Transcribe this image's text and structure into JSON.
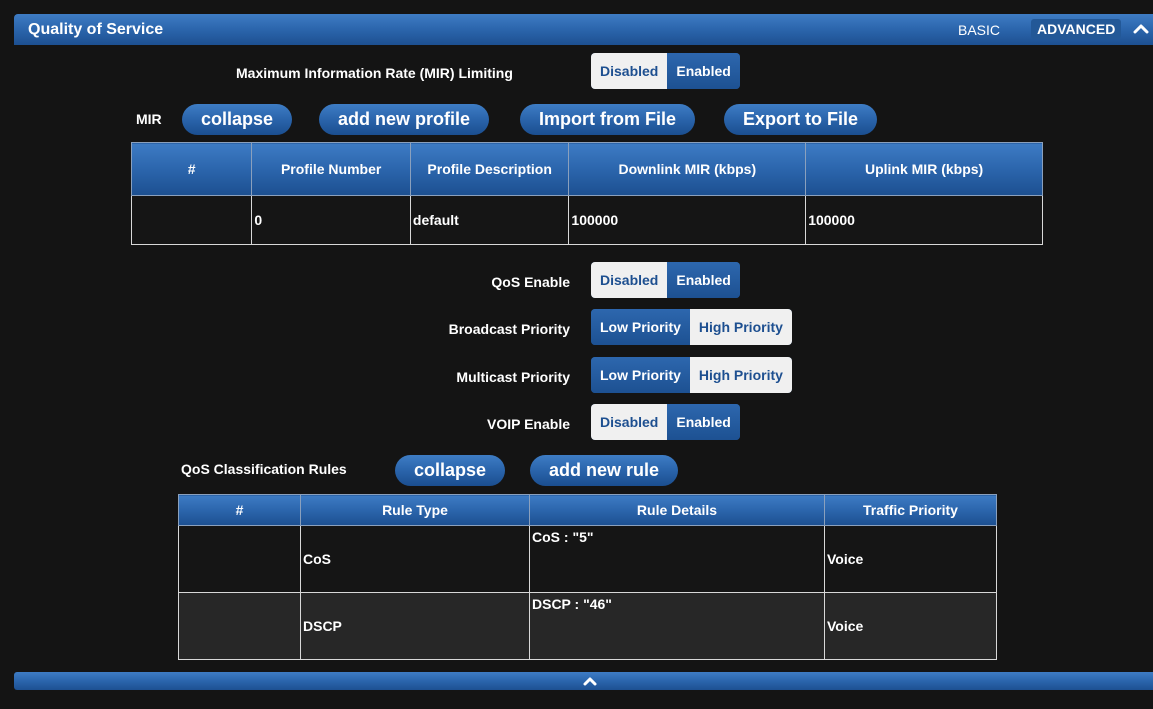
{
  "header": {
    "title": "Quality of Service",
    "basic_label": "BASIC",
    "advanced_label": "ADVANCED",
    "collapse_icon": "chevron-up-icon"
  },
  "mir_limiting": {
    "label": "Maximum Information Rate (MIR) Limiting",
    "options": [
      "Disabled",
      "Enabled"
    ],
    "selected": "Enabled"
  },
  "mir": {
    "label": "MIR",
    "collapse_label": "collapse",
    "add_profile_label": "add new profile",
    "import_label": "Import from File",
    "export_label": "Export to File",
    "table": {
      "headers": [
        "#",
        "Profile Number",
        "Profile Description",
        "Downlink MIR (kbps)",
        "Uplink MIR (kbps)"
      ],
      "rows": [
        {
          "index": "",
          "profile_number": "0",
          "description": "default",
          "downlink": "100000",
          "uplink": "100000"
        }
      ]
    }
  },
  "qos_enable": {
    "label": "QoS Enable",
    "options": [
      "Disabled",
      "Enabled"
    ],
    "selected": "Enabled"
  },
  "broadcast_priority": {
    "label": "Broadcast Priority",
    "options": [
      "Low Priority",
      "High Priority"
    ],
    "selected": "Low Priority"
  },
  "multicast_priority": {
    "label": "Multicast Priority",
    "options": [
      "Low Priority",
      "High Priority"
    ],
    "selected": "Low Priority"
  },
  "voip_enable": {
    "label": "VOIP Enable",
    "options": [
      "Disabled",
      "Enabled"
    ],
    "selected": "Enabled"
  },
  "rules": {
    "label": "QoS Classification Rules",
    "collapse_label": "collapse",
    "add_rule_label": "add new rule",
    "table": {
      "headers": [
        "#",
        "Rule Type",
        "Rule Details",
        "Traffic Priority"
      ],
      "rows": [
        {
          "index": "",
          "type": "CoS",
          "details": "CoS : \"5\"",
          "priority": "Voice"
        },
        {
          "index": "",
          "type": "DSCP",
          "details": "DSCP : \"46\"",
          "priority": "Voice"
        }
      ]
    }
  },
  "footer": {
    "expand_icon": "chevron-up-icon"
  },
  "colors": {
    "accent_blue": "#2a64ab",
    "background": "#141414",
    "toggle_light": "#f0f0f0"
  }
}
